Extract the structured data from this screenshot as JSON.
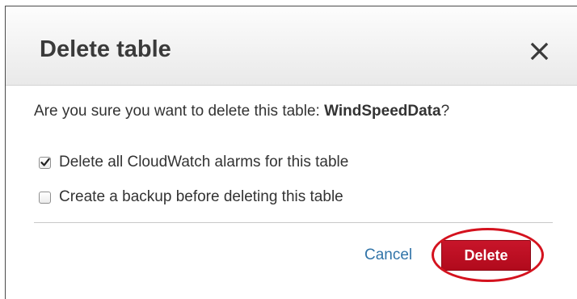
{
  "dialog": {
    "title": "Delete table",
    "close_icon": "close-icon",
    "question_prefix": "Are you sure you want to delete this table: ",
    "table_name": "WindSpeedData",
    "question_suffix": "?",
    "options": [
      {
        "label": "Delete all CloudWatch alarms for this table",
        "checked": true
      },
      {
        "label": "Create a backup before deleting this table",
        "checked": false
      }
    ],
    "cancel_label": "Cancel",
    "delete_label": "Delete"
  },
  "colors": {
    "delete_button": "#b10a1c",
    "cancel_link": "#3174a8",
    "highlight_ring": "#d4121e"
  }
}
